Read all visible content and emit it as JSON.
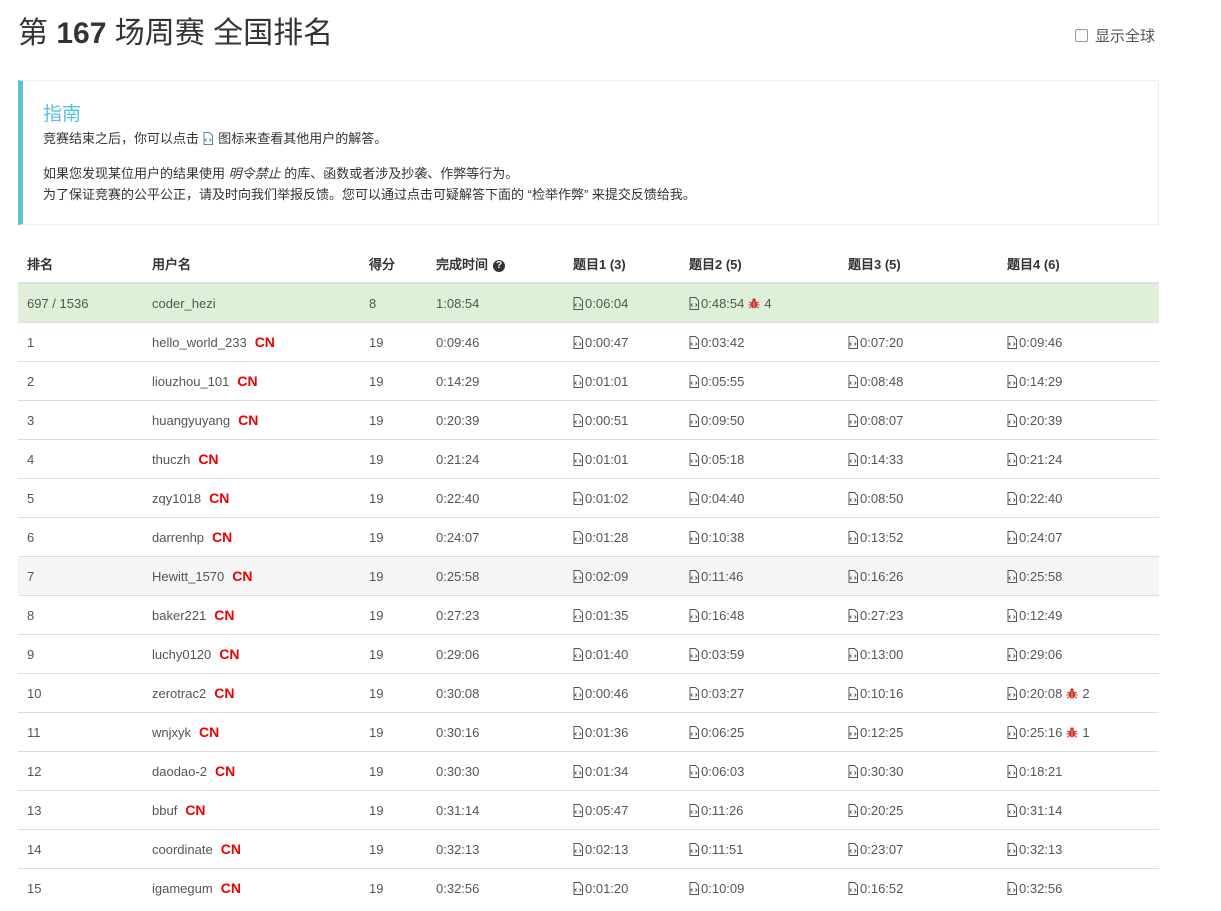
{
  "header": {
    "title_prefix": "第",
    "contest_number": "167",
    "title_suffix": "场周赛 全国排名",
    "global_toggle_label": "显示全球"
  },
  "guide": {
    "title": "指南",
    "line1_before": "竞赛结束之后，你可以点击",
    "line1_after": "图标来查看其他用户的解答。",
    "line2_before": "如果您发现某位用户的结果使用",
    "line2_em": "明令禁止",
    "line2_after": "的库、函数或者涉及抄袭、作弊等行为。",
    "line3": "为了保证竞赛的公平公正，请及时向我们举报反馈。您可以通过点击可疑解答下面的 “检举作弊” 来提交反馈给我。"
  },
  "table": {
    "headers": {
      "rank": "排名",
      "username": "用户名",
      "score": "得分",
      "finish_time": "完成时间",
      "q1": "题目1 (3)",
      "q2": "题目2 (5)",
      "q3": "题目3 (5)",
      "q4": "题目4 (6)"
    },
    "help_icon": "?",
    "country_label": "CN",
    "me": {
      "rank": "697 / 1536",
      "username": "coder_hezi",
      "score": "8",
      "finish": "1:08:54",
      "q1": "0:06:04",
      "q2": "0:48:54",
      "q2_penalty": "4"
    },
    "rows": [
      {
        "rank": "1",
        "username": "hello_world_233",
        "score": "19",
        "finish": "0:09:46",
        "q1": "0:00:47",
        "q2": "0:03:42",
        "q3": "0:07:20",
        "q4": "0:09:46"
      },
      {
        "rank": "2",
        "username": "liouzhou_101",
        "score": "19",
        "finish": "0:14:29",
        "q1": "0:01:01",
        "q2": "0:05:55",
        "q3": "0:08:48",
        "q4": "0:14:29"
      },
      {
        "rank": "3",
        "username": "huangyuyang",
        "score": "19",
        "finish": "0:20:39",
        "q1": "0:00:51",
        "q2": "0:09:50",
        "q3": "0:08:07",
        "q4": "0:20:39"
      },
      {
        "rank": "4",
        "username": "thuczh",
        "score": "19",
        "finish": "0:21:24",
        "q1": "0:01:01",
        "q2": "0:05:18",
        "q3": "0:14:33",
        "q4": "0:21:24"
      },
      {
        "rank": "5",
        "username": "zqy1018",
        "score": "19",
        "finish": "0:22:40",
        "q1": "0:01:02",
        "q2": "0:04:40",
        "q3": "0:08:50",
        "q4": "0:22:40"
      },
      {
        "rank": "6",
        "username": "darrenhp",
        "score": "19",
        "finish": "0:24:07",
        "q1": "0:01:28",
        "q2": "0:10:38",
        "q3": "0:13:52",
        "q4": "0:24:07"
      },
      {
        "rank": "7",
        "username": "Hewitt_1570",
        "score": "19",
        "finish": "0:25:58",
        "q1": "0:02:09",
        "q2": "0:11:46",
        "q3": "0:16:26",
        "q4": "0:25:58"
      },
      {
        "rank": "8",
        "username": "baker221",
        "score": "19",
        "finish": "0:27:23",
        "q1": "0:01:35",
        "q2": "0:16:48",
        "q3": "0:27:23",
        "q4": "0:12:49"
      },
      {
        "rank": "9",
        "username": "luchy0120",
        "score": "19",
        "finish": "0:29:06",
        "q1": "0:01:40",
        "q2": "0:03:59",
        "q3": "0:13:00",
        "q4": "0:29:06"
      },
      {
        "rank": "10",
        "username": "zerotrac2",
        "score": "19",
        "finish": "0:30:08",
        "q1": "0:00:46",
        "q2": "0:03:27",
        "q3": "0:10:16",
        "q4": "0:20:08",
        "q4_penalty": "2"
      },
      {
        "rank": "11",
        "username": "wnjxyk",
        "score": "19",
        "finish": "0:30:16",
        "q1": "0:01:36",
        "q2": "0:06:25",
        "q3": "0:12:25",
        "q4": "0:25:16",
        "q4_penalty": "1"
      },
      {
        "rank": "12",
        "username": "daodao-2",
        "score": "19",
        "finish": "0:30:30",
        "q1": "0:01:34",
        "q2": "0:06:03",
        "q3": "0:30:30",
        "q4": "0:18:21"
      },
      {
        "rank": "13",
        "username": "bbuf",
        "score": "19",
        "finish": "0:31:14",
        "q1": "0:05:47",
        "q2": "0:11:26",
        "q3": "0:20:25",
        "q4": "0:31:14"
      },
      {
        "rank": "14",
        "username": "coordinate",
        "score": "19",
        "finish": "0:32:13",
        "q1": "0:02:13",
        "q2": "0:11:51",
        "q3": "0:23:07",
        "q4": "0:32:13"
      },
      {
        "rank": "15",
        "username": "igamegum",
        "score": "19",
        "finish": "0:32:56",
        "q1": "0:01:20",
        "q2": "0:10:09",
        "q3": "0:16:52",
        "q4": "0:32:56"
      }
    ]
  },
  "colors": {
    "guide_accent": "#5bc0de",
    "my_row_bg": "#dff0d8",
    "country_flag": "#e00000",
    "bug_icon": "#c9302c"
  },
  "icons": {
    "solution": "code-file-icon",
    "penalty": "bug-icon",
    "help": "question-circle-icon",
    "toggle": "checkbox-icon"
  }
}
